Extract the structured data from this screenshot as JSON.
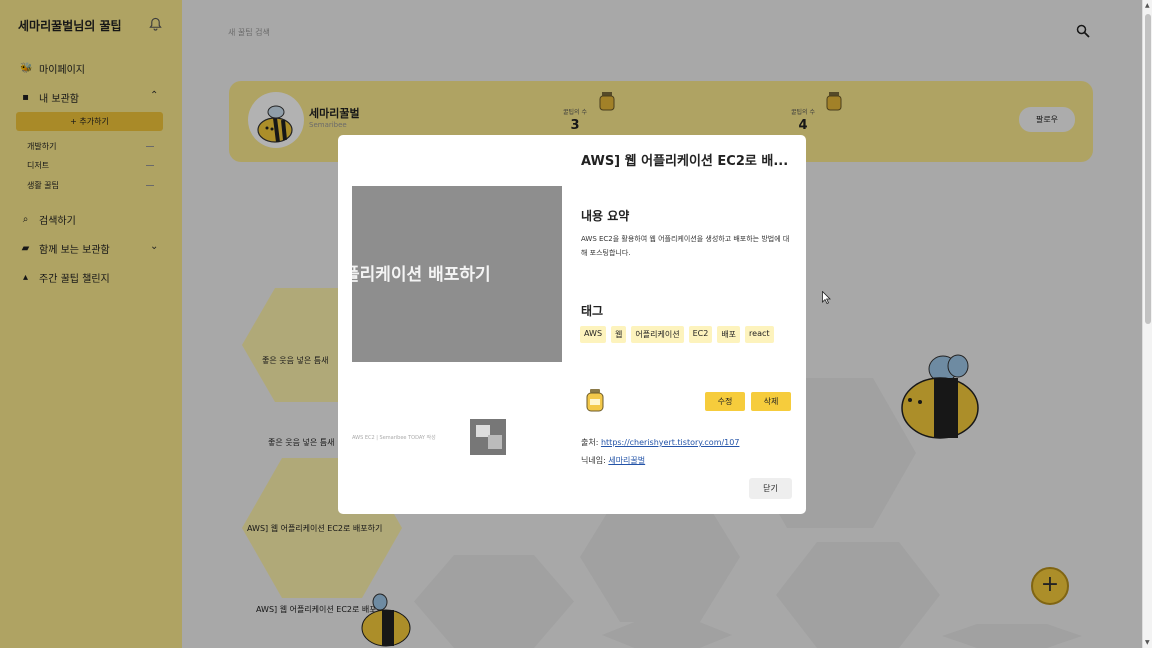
{
  "sidebar": {
    "title": "세마리꿀벌님의 꿀팁",
    "nav": {
      "mypage": "마이페이지",
      "storage": "내 보관함",
      "search": "검색하기",
      "shared": "함께 보는 보관함",
      "challenge": "주간 꿀팁 챌린지"
    },
    "add_label": "+ 추가하기",
    "subitems": [
      "개발하기",
      "디저트",
      "생활 꿀팁"
    ]
  },
  "main": {
    "search_placeholder": "새 꿀팁 검색",
    "profile": {
      "name": "세마리꿀벌",
      "subtitle": "Semaribee",
      "stats": [
        {
          "label": "꿀팁의 수",
          "value": "3"
        },
        {
          "label": "꿀팁의 수",
          "value": "4"
        }
      ],
      "follow_label": "팔로우"
    },
    "hex_labels": [
      "좋은 웃음 넣은 틈새",
      "좋은 웃음 넣은 틈새",
      "AWS] 웹 어플리케이션 EC2로 배포하기",
      "AWS] 웹 어플리케이션 EC2로 배포하"
    ],
    "fab_label": "+"
  },
  "modal": {
    "title": "AWS] 웹 어플리케이션 EC2로 배...",
    "image_text": "플리케이션 배포하기",
    "image_caption": "AWS EC2 | Semaribee TODAY 작성",
    "summary_heading": "내용 요약",
    "summary": "AWS EC2을 활용하여 웹 어플리케이션을 생성하고 배포하는 방법에 대해 포스팅합니다.",
    "tags_heading": "태그",
    "tags": [
      "AWS",
      "웹",
      "어플리케이션",
      "EC2",
      "배포",
      "react"
    ],
    "edit_label": "수정",
    "delete_label": "삭제",
    "source_label": "출처: ",
    "source_url": "https://cherishyert.tistory.com/107",
    "nickname_label": "닉네임: ",
    "nickname": "세마리꿀벌",
    "close_label": "닫기"
  },
  "colors": {
    "sidebar_bg": "#fbea8e",
    "accent": "#f6cc3c",
    "tag_bg": "#fdf3bd",
    "link": "#2454a8"
  }
}
